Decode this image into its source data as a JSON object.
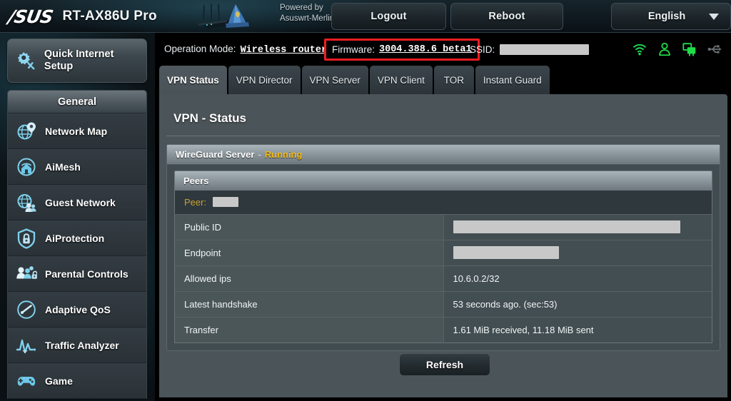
{
  "header": {
    "brand": "/SUS",
    "model": "RT-AX86U Pro",
    "powered_by_line1": "Powered by",
    "powered_by_line2": "Asuswrt-Merlin",
    "logout_label": "Logout",
    "reboot_label": "Reboot",
    "language": "English"
  },
  "infobar": {
    "operation_mode_label": "Operation Mode:",
    "operation_mode_value": "Wireless router",
    "firmware_label": "Firmware:",
    "firmware_value": "3004.388.6_beta1",
    "ssid_label": "SSID:",
    "ssid_value": "",
    "highlight_color": "#ef1d22",
    "icons": [
      {
        "name": "wifi-status-icon",
        "state": "active",
        "color": "#1fdb4a"
      },
      {
        "name": "client-user-status-icon",
        "state": "active",
        "color": "#1fdb4a"
      },
      {
        "name": "connected-devices-status-icon",
        "state": "active",
        "color": "#1fdb4a"
      },
      {
        "name": "usb-status-icon",
        "state": "inactive",
        "color": "#6a6f72"
      }
    ]
  },
  "sidebar": {
    "quick_internet_setup": "Quick Internet Setup",
    "section_title": "General",
    "items": [
      {
        "label": "Network Map",
        "icon": "globe-pin-icon"
      },
      {
        "label": "AiMesh",
        "icon": "mesh-house-icon"
      },
      {
        "label": "Guest Network",
        "icon": "globe-users-icon"
      },
      {
        "label": "AiProtection",
        "icon": "shield-lock-icon"
      },
      {
        "label": "Parental Controls",
        "icon": "people-lock-icon"
      },
      {
        "label": "Adaptive QoS",
        "icon": "speedometer-icon"
      },
      {
        "label": "Traffic Analyzer",
        "icon": "waveform-icon"
      },
      {
        "label": "Game",
        "icon": "gamepad-icon"
      }
    ]
  },
  "tabs": [
    {
      "label": "VPN Status",
      "active": true
    },
    {
      "label": "VPN Director",
      "active": false
    },
    {
      "label": "VPN Server",
      "active": false
    },
    {
      "label": "VPN Client",
      "active": false
    },
    {
      "label": "TOR",
      "active": false
    },
    {
      "label": "Instant Guard",
      "active": false
    }
  ],
  "main": {
    "page_title": "VPN - Status",
    "server": {
      "name": "WireGuard Server",
      "separator": "-",
      "state": "Running",
      "state_color": "#f3b913"
    },
    "peers_header": "Peers",
    "peer_label": "Peer:",
    "peer_value": "",
    "rows": [
      {
        "key": "Public ID",
        "value": "",
        "redacted": true,
        "redact_width": 318
      },
      {
        "key": "Endpoint",
        "value": "",
        "redacted": true,
        "redact_width": 148
      },
      {
        "key": "Allowed ips",
        "value": "10.6.0.2/32",
        "redacted": false,
        "redact_width": 0
      },
      {
        "key": "Latest handshake",
        "value": "53 seconds ago. (sec:53)",
        "redacted": false,
        "redact_width": 0
      },
      {
        "key": "Transfer",
        "value": "1.61 MiB received, 11.18 MiB sent",
        "redacted": false,
        "redact_width": 0
      }
    ],
    "refresh_label": "Refresh"
  }
}
